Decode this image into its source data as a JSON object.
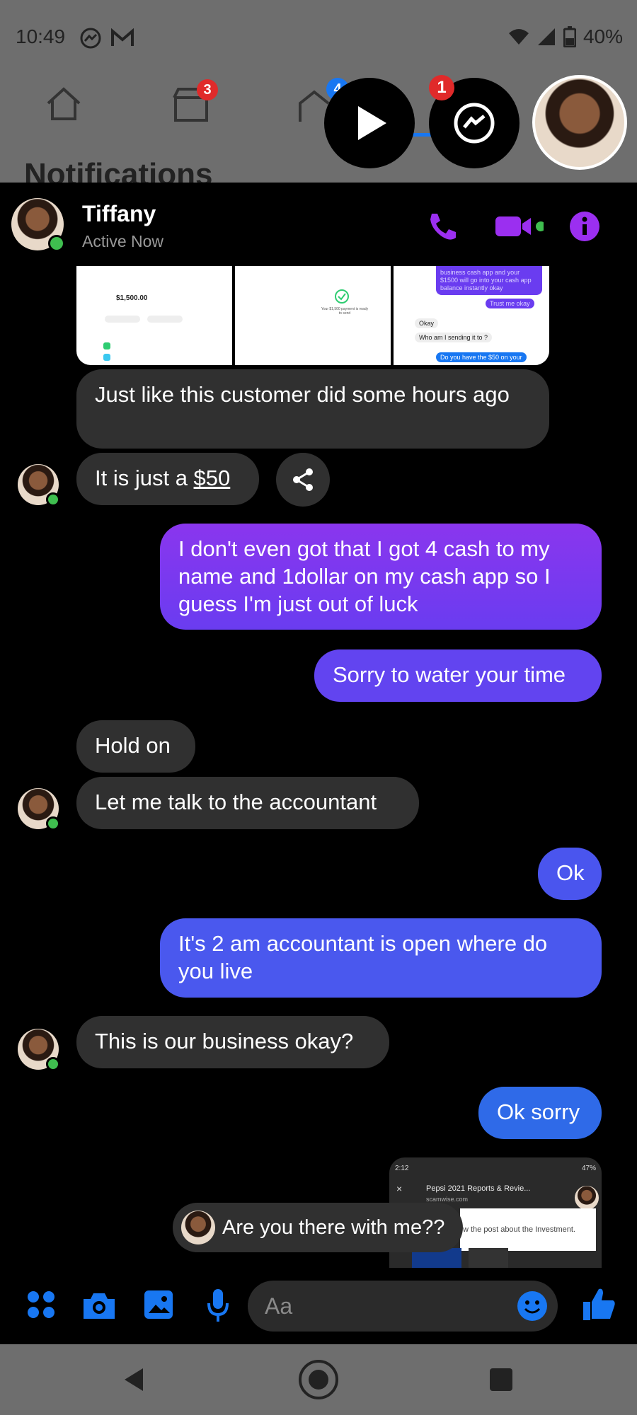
{
  "status_bar": {
    "time": "10:49",
    "battery": "40%"
  },
  "fb_nav": {
    "marketplace_badge": "3",
    "notifications_badge": "4",
    "messenger_badge": "1"
  },
  "background": {
    "page_title": "Notifications"
  },
  "chat": {
    "name": "Tiffany",
    "status": "Active Now",
    "accent_color": "#9b2ff0",
    "messages": [
      {
        "side": "left",
        "text": "Just like this customer did some hours ago"
      },
      {
        "side": "left",
        "text_prefix": "It is just a ",
        "link": "$50"
      },
      {
        "side": "right",
        "text": "I don't even got that I got 4 cash to my name and 1dollar on my cash app so I guess I'm just out of luck"
      },
      {
        "side": "right",
        "text": "Sorry to water your time"
      },
      {
        "side": "left",
        "text": "Hold on"
      },
      {
        "side": "left",
        "text": "Let me talk to the accountant"
      },
      {
        "side": "right",
        "text": "Ok"
      },
      {
        "side": "right",
        "text": "It's 2 am accountant is open where do you live"
      },
      {
        "side": "left",
        "text": "This is our business okay?"
      },
      {
        "side": "right",
        "text": "Ok sorry"
      }
    ],
    "screenshot_strip": {
      "amount": "$1,500.00",
      "success_text": "Your $1,500 payment is ready to send",
      "convo_lines": [
        "business cash app and your $1500 will go into your cash app balance instantly okay",
        "Trust me okay",
        "Okay",
        "Who am I sending it to ?",
        "Do you have the $50 on your"
      ]
    },
    "shared_preview": {
      "time": "2:12",
      "battery": "47%",
      "page_title": "Pepsi 2021 Reports & Revie...",
      "url": "scamwise.com",
      "snippet": "w the post about the Investment."
    },
    "typing_preview": "Are you there with me??",
    "composer_placeholder": "Aa"
  }
}
